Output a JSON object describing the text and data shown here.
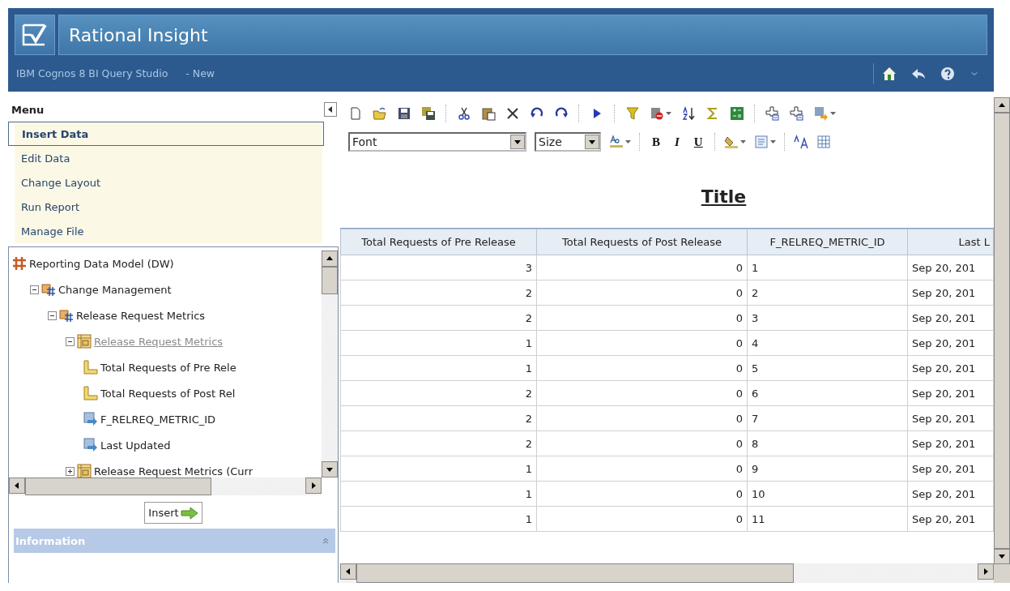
{
  "header": {
    "title": "Rational Insight",
    "subtitle": "IBM Cognos 8 BI Query Studio",
    "document": "- New"
  },
  "menu": {
    "title": "Menu",
    "items": [
      {
        "label": "Insert Data",
        "selected": true
      },
      {
        "label": "Edit Data",
        "selected": false
      },
      {
        "label": "Change Layout",
        "selected": false
      },
      {
        "label": "Run Report",
        "selected": false
      },
      {
        "label": "Manage File",
        "selected": false
      }
    ]
  },
  "tree": [
    {
      "label": "Reporting Data Model (DW)",
      "kind": "namespace",
      "selected": false,
      "children": [
        {
          "label": "Change Management",
          "kind": "folder",
          "expanded": true,
          "selected": false,
          "children": [
            {
              "label": "Release Request Metrics",
              "kind": "folder",
              "expanded": true,
              "selected": false,
              "children": [
                {
                  "label": "Release Request Metrics",
                  "kind": "query_subject",
                  "expanded": true,
                  "selected": true,
                  "children": [
                    {
                      "label": "Total Requests of Pre Rele",
                      "kind": "measure",
                      "selected": false
                    },
                    {
                      "label": "Total Requests of Post Rel",
                      "kind": "measure",
                      "selected": false
                    },
                    {
                      "label": "F_RELREQ_METRIC_ID",
                      "kind": "attribute",
                      "selected": false
                    },
                    {
                      "label": "Last Updated",
                      "kind": "attribute",
                      "selected": false
                    }
                  ]
                },
                {
                  "label": "Release Request Metrics (Curr",
                  "kind": "query_subject",
                  "expanded": false,
                  "selected": false
                }
              ]
            }
          ]
        }
      ]
    }
  ],
  "insert_button": "Insert",
  "information_panel": {
    "title": "Information"
  },
  "toolbar": {
    "font": "Font",
    "size": "Size",
    "format_buttons": [
      "B",
      "I",
      "U"
    ]
  },
  "report": {
    "title": "Title",
    "table": {
      "columns": [
        "Total Requests of Pre Release",
        "Total Requests of Post Release",
        "F_RELREQ_METRIC_ID",
        "Last L"
      ],
      "rows": [
        [
          "3",
          "0",
          "1",
          "Sep 20, 201"
        ],
        [
          "2",
          "0",
          "2",
          "Sep 20, 201"
        ],
        [
          "2",
          "0",
          "3",
          "Sep 20, 201"
        ],
        [
          "1",
          "0",
          "4",
          "Sep 20, 201"
        ],
        [
          "1",
          "0",
          "5",
          "Sep 20, 201"
        ],
        [
          "2",
          "0",
          "6",
          "Sep 20, 201"
        ],
        [
          "2",
          "0",
          "7",
          "Sep 20, 201"
        ],
        [
          "2",
          "0",
          "8",
          "Sep 20, 201"
        ],
        [
          "1",
          "0",
          "9",
          "Sep 20, 201"
        ],
        [
          "1",
          "0",
          "10",
          "Sep 20, 201"
        ],
        [
          "1",
          "0",
          "11",
          "Sep 20, 201"
        ]
      ]
    }
  }
}
